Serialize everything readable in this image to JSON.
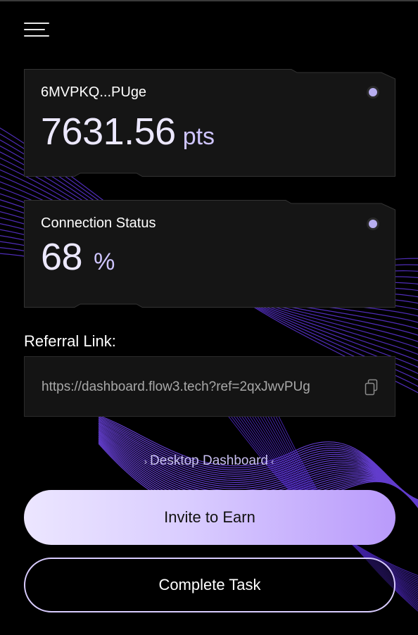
{
  "wallet_card": {
    "address": "6MVPKQ...PUge",
    "points": "7631.56",
    "points_unit": "pts"
  },
  "connection_card": {
    "title": "Connection Status",
    "value": "68",
    "unit": "%"
  },
  "referral": {
    "label": "Referral Link:",
    "url": "https://dashboard.flow3.tech?ref=2qxJwvPUg"
  },
  "desktop_link": {
    "label": "Desktop Dashboard",
    "left_chevron": "›",
    "right_chevron": "‹"
  },
  "buttons": {
    "invite": "Invite to Earn",
    "task": "Complete Task"
  },
  "icons": {
    "menu": "hamburger-menu-icon",
    "copy": "copy-icon",
    "status_dot": "status-dot-icon"
  },
  "colors": {
    "accent": "#b99afb",
    "accent_light": "#ece6ff",
    "wave": "#6a3cf5",
    "card_bg": "#151515"
  }
}
